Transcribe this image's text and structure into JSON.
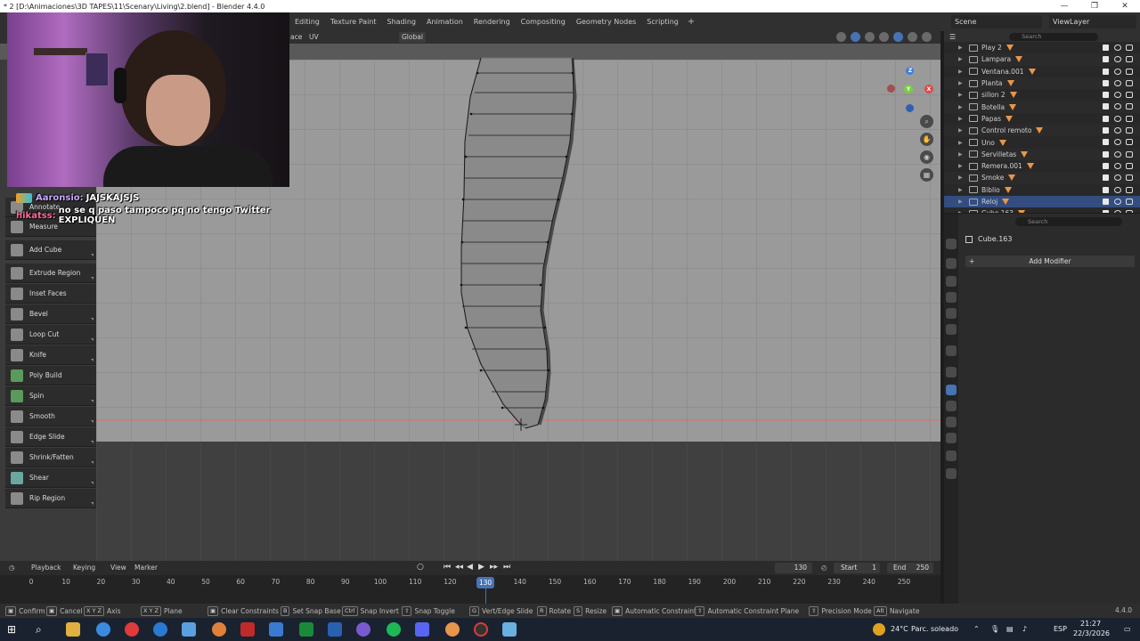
{
  "window": {
    "title": "* 2 [D:\\Animaciones\\3D TAPES\\11\\Scenary\\Living\\2.blend] - Blender 4.4.0",
    "controls": [
      "—",
      "❐",
      "✕"
    ]
  },
  "workspaces": [
    "Editing",
    "Texture Paint",
    "Shading",
    "Animation",
    "Rendering",
    "Compositing",
    "Geometry Nodes",
    "Scripting",
    "+"
  ],
  "top_right": {
    "scene": "Scene",
    "view_layer": "ViewLayer"
  },
  "viewport_header": {
    "mode_tail": "ace",
    "uv_menu": "UV",
    "orientation": "Global"
  },
  "chat": [
    {
      "user": "Aaronsio:",
      "message": "JAJSKAJSJS"
    },
    {
      "user": "hikatss:",
      "message": "no se q paso tampoco pq no tengo Twitter EXPLIQUEN"
    }
  ],
  "tools": [
    "Annotate",
    "Measure",
    "Add Cube",
    "Extrude Region",
    "Inset Faces",
    "Bevel",
    "Loop Cut",
    "Knife",
    "Poly Build",
    "Spin",
    "Smooth",
    "Edge Slide",
    "Shrink/Fatten",
    "Shear",
    "Rip Region"
  ],
  "gizmo": {
    "z": "Z",
    "y": "Y",
    "x": "X"
  },
  "outliner": {
    "search_placeholder": "Search",
    "items": [
      "Play 2",
      "Lampara",
      "Ventana.001",
      "Planta",
      "sillon 2",
      "Botella",
      "Papas",
      "Control remoto",
      "Uno",
      "Servilletas",
      "Remera.001",
      "Smoke",
      "Biblio",
      "Reloj",
      "Cube.163"
    ]
  },
  "properties": {
    "search_placeholder": "Search",
    "object_name": "Cube.163",
    "add_modifier": "Add Modifier"
  },
  "timeline": {
    "menus": [
      "Playback",
      "Keying",
      "View",
      "Marker"
    ],
    "current_frame": "130",
    "start_label": "Start",
    "start": "1",
    "end_label": "End",
    "end": "250",
    "ticks": [
      "0",
      "10",
      "20",
      "30",
      "40",
      "50",
      "60",
      "70",
      "80",
      "90",
      "100",
      "110",
      "120",
      "130",
      "140",
      "150",
      "160",
      "170",
      "180",
      "190",
      "200",
      "210",
      "220",
      "230",
      "240",
      "250"
    ]
  },
  "statusbar": [
    {
      "key": "",
      "label": "Confirm"
    },
    {
      "key": "",
      "label": "Cancel"
    },
    {
      "key": "X Y Z",
      "label": "Axis"
    },
    {
      "key": "X Y Z",
      "label": "Plane"
    },
    {
      "key": "",
      "label": "Clear Constraints"
    },
    {
      "key": "B",
      "label": "Set Snap Base"
    },
    {
      "key": "Ctrl",
      "label": "Snap Invert"
    },
    {
      "key": "",
      "label": "Snap Toggle"
    },
    {
      "key": "G",
      "label": "Vert/Edge Slide"
    },
    {
      "key": "R",
      "label": "Rotate"
    },
    {
      "key": "S",
      "label": "Resize"
    },
    {
      "key": "",
      "label": "Automatic Constraint"
    },
    {
      "key": "",
      "label": "Automatic Constraint Plane"
    },
    {
      "key": "",
      "label": "Precision Mode"
    },
    {
      "key": "Alt",
      "label": "Navigate"
    }
  ],
  "version": "4.4.0",
  "taskbar": {
    "weather": "24°C",
    "weather_desc": "Parc. soleado",
    "lang": "ESP",
    "time": "21:27",
    "date": "22/3/2026"
  },
  "colors": {
    "accent": "#4772b3",
    "object_orange": "#e8964a",
    "chat_user1": "#c8a8ff",
    "chat_user2": "#ff6a9a"
  }
}
